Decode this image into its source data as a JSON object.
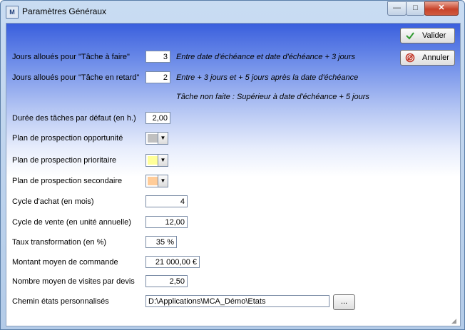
{
  "window": {
    "title": "Paramètres Généraux",
    "app_icon_text": "M",
    "buttons": {
      "minimize": "—",
      "maximize": "□",
      "close": "✕"
    }
  },
  "actions": {
    "valider": "Valider",
    "annuler": "Annuler"
  },
  "fields": {
    "taf": {
      "label": "Jours alloués pour \"Tâche à faire\"",
      "value": "3",
      "note": "Entre date d'échéance et date d'échéance + 3 jours"
    },
    "ter": {
      "label": "Jours alloués pour \"Tâche en retard\"",
      "value": "2",
      "note": "Entre + 3 jours et + 5 jours après la date d'échéance"
    },
    "non_faite_note": "Tâche non faite : Supérieur à date d'échéance + 5 jours",
    "duree": {
      "label": "Durée des tâches par défaut (en h.)",
      "value": "2,00"
    },
    "plan_opp": {
      "label": "Plan de prospection opportunité",
      "color": "#c0c0c0"
    },
    "plan_prio": {
      "label": "Plan de prospection prioritaire",
      "color": "#ffff99"
    },
    "plan_sec": {
      "label": "Plan de prospection secondaire",
      "color": "#ffcc99"
    },
    "cycle_achat": {
      "label": "Cycle d'achat (en mois)",
      "value": "4"
    },
    "cycle_vente": {
      "label": "Cycle de vente (en unité annuelle)",
      "value": "12,00"
    },
    "taux": {
      "label": "Taux transformation (en %)",
      "value": "35 %"
    },
    "montant": {
      "label": "Montant moyen de commande",
      "value": "21 000,00 €"
    },
    "visites": {
      "label": "Nombre moyen de visites par devis",
      "value": "2,50"
    },
    "chemin": {
      "label": "Chemin états personnalisés",
      "value": "D:\\Applications\\MCA_Démo\\Etats",
      "browse": "..."
    }
  }
}
